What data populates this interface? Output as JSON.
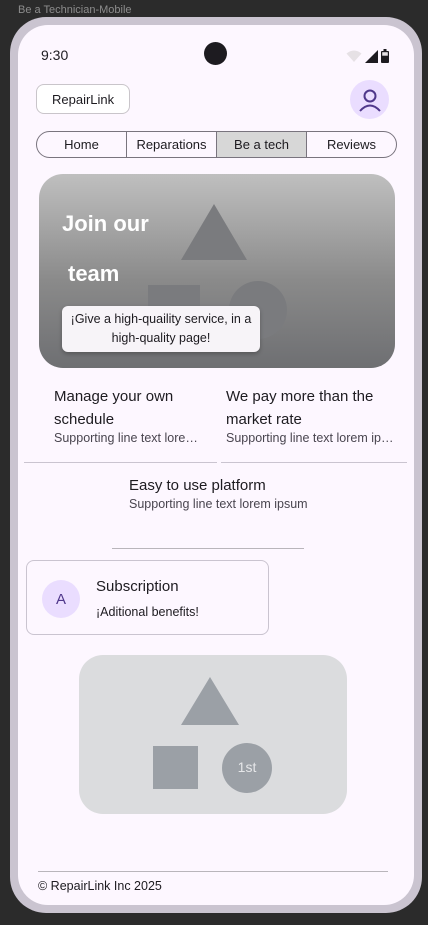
{
  "frame": {
    "label": "Be a Technician-Mobile"
  },
  "status_bar": {
    "time": "9:30"
  },
  "header": {
    "brand_label": "RepairLink"
  },
  "nav": {
    "tabs": [
      {
        "label": "Home",
        "active": false
      },
      {
        "label": "Reparations",
        "active": false
      },
      {
        "label": "Be a tech",
        "active": true
      },
      {
        "label": "Reviews",
        "active": false
      }
    ]
  },
  "hero": {
    "title_line1": "Join our",
    "title_line2": "team",
    "caption": "¡Give a high-quaility service, in a high-quality page!"
  },
  "features": [
    {
      "title": "Manage your own schedule",
      "subtitle": "Supporting line text lorem ipsum"
    },
    {
      "title": "We pay more than the market rate",
      "subtitle": "Supporting line text lorem ipsum"
    },
    {
      "title": "Easy to use platform",
      "subtitle": "Supporting line text lorem ipsum"
    }
  ],
  "subscription": {
    "avatar_letter": "A",
    "title": "Subscription",
    "subtitle": "¡Aditional benefits!"
  },
  "media_placeholder": {
    "badge": "1st"
  },
  "footer": {
    "copyright": "© RepairLink Inc 2025"
  },
  "colors": {
    "background": "#fdf7ff",
    "phone_frame": "#cac4d0",
    "avatar_bg": "#eaddff",
    "avatar_fg": "#4f378b",
    "active_tab": "#d7d7d7"
  }
}
